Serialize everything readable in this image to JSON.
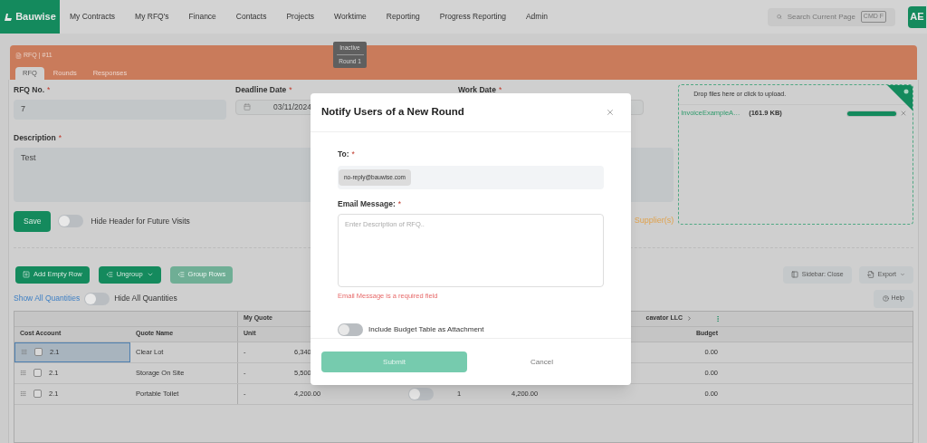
{
  "nav": {
    "logo": "Bauwise",
    "items": [
      "My Contracts",
      "My RFQ's",
      "Finance",
      "Contacts",
      "Projects",
      "Worktime",
      "Reporting",
      "Progress Reporting",
      "Admin"
    ],
    "search": {
      "placeholder": "Search Current Page",
      "shortcut": "CMD F"
    },
    "avatar": "AE"
  },
  "rfq_card": {
    "title": "RFQ | #11",
    "tabs": [
      {
        "label": "RFQ",
        "selected": true
      },
      {
        "label": "Rounds",
        "selected": false
      },
      {
        "label": "Responses",
        "selected": false
      }
    ],
    "status_tooltip": {
      "status": "Inactive",
      "round": "Round 1"
    }
  },
  "form": {
    "rfq_no": {
      "label": "RFQ No.",
      "required_mark": "*",
      "value": "7"
    },
    "deadline": {
      "label": "Deadline Date",
      "required_mark": "*",
      "value": "03/11/2024"
    },
    "work_date": {
      "label": "Work Date",
      "required_mark": "*"
    },
    "description": {
      "label": "Description",
      "required_mark": "*",
      "value": "Test"
    },
    "save": "Save",
    "hide_header": {
      "label": "Hide Header for Future Visits",
      "on": false
    },
    "suppliers_link": "Supplier(s)"
  },
  "upload": {
    "prompt": "Drop files here or click to upload.",
    "files": [
      {
        "name": "InvoiceExampleA…",
        "size": "(161.9 KB)",
        "level": 1
      }
    ]
  },
  "toolbar": {
    "left": [
      {
        "label": "Add Empty Row",
        "kind": "add",
        "disabled": false
      },
      {
        "label": "Ungroup",
        "kind": "dropdown",
        "disabled": false
      },
      {
        "label": "Group Rows",
        "kind": "group",
        "disabled": true
      }
    ],
    "right": [
      {
        "label": "Sidebar: Close",
        "kind": "sidebar"
      },
      {
        "label": "Export",
        "kind": "export"
      }
    ],
    "help": "Help"
  },
  "quantities": {
    "show_link": "Show All Quantities",
    "hide_toggle": {
      "label": "Hide All Quantities",
      "on": false
    }
  },
  "table": {
    "group_headers": {
      "my_quote": "My Quote",
      "supplier": "cavator LLC"
    },
    "columns": {
      "cost_account": "Cost Account",
      "quote_name": "Quote Name",
      "unit": "Unit",
      "budget": "Budget"
    },
    "rows": [
      {
        "selected": true,
        "checked": false,
        "cost_account": "2.1",
        "quote_name": "Clear Lot",
        "unit": "-",
        "price": "6,340",
        "budget": "0.00"
      },
      {
        "selected": false,
        "checked": false,
        "cost_account": "2.1",
        "quote_name": "Storage On Site",
        "unit": "-",
        "price": "5,500",
        "budget": "0.00"
      },
      {
        "selected": false,
        "checked": false,
        "cost_account": "2.1",
        "quote_name": "Portable Toilet",
        "unit": "-",
        "price": "4,200.00",
        "toggle_on": false,
        "quantity": "1",
        "total": "4,200.00",
        "budget": "0.00"
      }
    ]
  },
  "modal": {
    "title": "Notify Users of a New Round",
    "to": {
      "label": "To:",
      "required_mark": "*",
      "recipients": [
        "no-reply@bauwise.com"
      ]
    },
    "message": {
      "label": "Email Message:",
      "required_mark": "*",
      "placeholder": "Enter Description of RFQ..",
      "error": "Email Message is a required field"
    },
    "attach_toggle": {
      "label": "Include Budget Table as Attachment",
      "on": false
    },
    "submit": "Submit",
    "cancel": "Cancel"
  }
}
